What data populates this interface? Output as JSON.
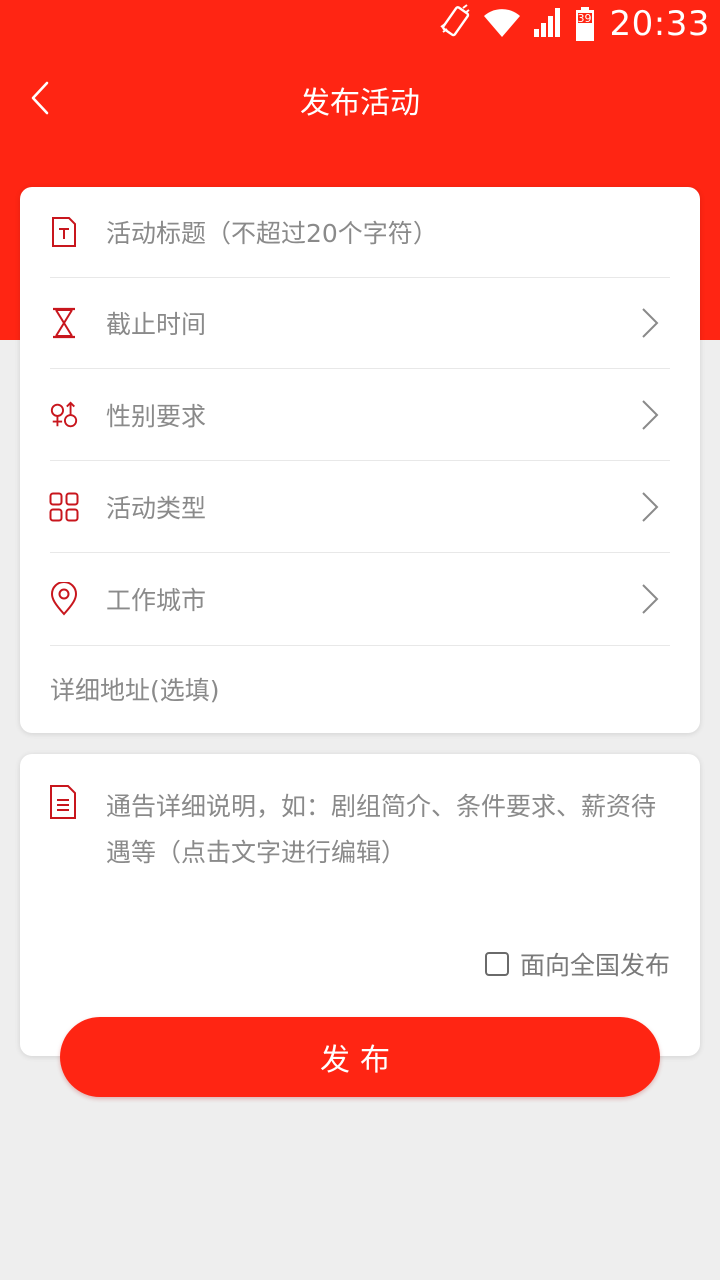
{
  "status_bar": {
    "time": "20:33",
    "battery_level": "39",
    "icons": [
      "vibrate-icon",
      "wifi-icon",
      "signal-icon",
      "battery-icon"
    ]
  },
  "header": {
    "title": "发布活动",
    "back_icon": "chevron-left-icon"
  },
  "form": {
    "title_placeholder": "活动标题（不超过20个字符）",
    "deadline_label": "截止时间",
    "gender_label": "性别要求",
    "type_label": "活动类型",
    "city_label": "工作城市",
    "address_placeholder": "详细地址(选填)"
  },
  "description": {
    "placeholder": "通告详细说明，如：剧组简介、条件要求、薪资待遇等（点击文字进行编辑）"
  },
  "nationwide": {
    "label": "面向全国发布",
    "checked": false
  },
  "publish_button": {
    "label": "发布"
  },
  "colors": {
    "primary": "#ff2513",
    "icon": "#c8161d",
    "text_muted": "#8a8a8a",
    "background": "#eeeeee"
  }
}
